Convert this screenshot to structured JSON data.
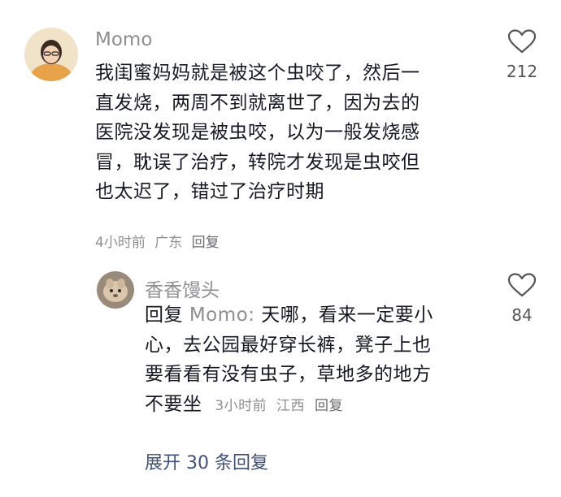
{
  "comments": [
    {
      "user": "Momo",
      "avatar_icon": "avatar-user-momo",
      "text_lines": [
        "我闺蜜妈妈就是被这个虫咬了，然后一",
        "直发烧，两周不到就离世了，因为去的",
        "医院没发现是被虫咬，以为一般发烧感",
        "冒，耽误了治疗，转院才发现是虫咬但",
        "也太迟了，错过了治疗时期"
      ],
      "time": "4小时前",
      "location": "广东",
      "reply_label": "回复",
      "likes": "212"
    }
  ],
  "reply": {
    "user": "香香馒头",
    "avatar_icon": "avatar-user-xiangxiang",
    "prefix": "回复",
    "reply_to": "Momo:",
    "text_lines": [
      "天哪，看来一定要小",
      "心，去公园最好穿长裤，凳子上也",
      "要看看有没有虫子，草地多的地方",
      "不要坐"
    ],
    "time": "3小时前",
    "location": "江西",
    "reply_label": "回复",
    "likes": "84"
  },
  "expand_label": "展开 30 条回复",
  "colors": {
    "meta_gray": "#8e8e93",
    "text": "#161823",
    "expand": "#40507a"
  }
}
